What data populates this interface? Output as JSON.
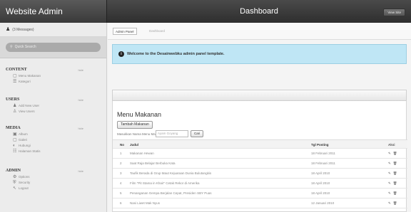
{
  "header": {
    "brand": "Website Admin",
    "title": "Dashboard",
    "view_site": "View Site"
  },
  "sidebar": {
    "messages": "(3 Messages)",
    "search_placeholder": "Quick Search",
    "sections": [
      {
        "title": "CONTENT",
        "toggle": "hide",
        "items": [
          {
            "icon": "document-icon",
            "glyph": "▢",
            "label": "Menu Makanan"
          },
          {
            "icon": "list-icon",
            "glyph": "☰",
            "label": "Kategori"
          }
        ]
      },
      {
        "title": "USERS",
        "toggle": "hide",
        "items": [
          {
            "icon": "add-user-icon",
            "glyph": "♟",
            "label": "Add New User"
          },
          {
            "icon": "users-icon",
            "glyph": "♙",
            "label": "View Users"
          }
        ]
      },
      {
        "title": "MEDIA",
        "toggle": "hide",
        "items": [
          {
            "icon": "album-icon",
            "glyph": "▣",
            "label": "Album"
          },
          {
            "icon": "gallery-icon",
            "glyph": "▢",
            "label": "Galeri"
          },
          {
            "icon": "hubungi-icon",
            "glyph": "◐",
            "label": "Hubungi"
          },
          {
            "icon": "stats-icon",
            "glyph": "☷",
            "label": "Halaman Statis"
          }
        ]
      },
      {
        "title": "ADMIN",
        "toggle": "hide",
        "items": [
          {
            "icon": "options-icon",
            "glyph": "⚙",
            "label": "Options"
          },
          {
            "icon": "security-icon",
            "glyph": "⛨",
            "label": "Security"
          },
          {
            "icon": "logout-icon",
            "glyph": "↖",
            "label": "Logout"
          }
        ]
      }
    ]
  },
  "breadcrumb": {
    "active": "Admin Panel",
    "inactive": "Dashboard"
  },
  "notice": "Welcome to the Desainwebku admin panel template.",
  "panel": {
    "title": "Menu Makanan",
    "add_button": "Tambah Makanan",
    "search_label": "Masukkan Nama Menu Makanan :",
    "search_placeholder": "Ayam Goyang",
    "search_button": "Cari",
    "columns": {
      "no": "No",
      "judul": "Judul",
      "tgl": "Tgl Posting",
      "aksi": "Aksi"
    },
    "rows": [
      {
        "no": "1",
        "judul": "Makanan Hewan",
        "tgl": "18 Februari 2011"
      },
      {
        "no": "2",
        "judul": "Saat Raja Belajar Berbuka Kata",
        "tgl": "18 Februari 2011"
      },
      {
        "no": "3",
        "judul": "Taufik Berada di Grup Maut Kejuaraan Dunia Bulutangkis",
        "tgl": "18 April 2010"
      },
      {
        "no": "4",
        "judul": "Film \"Pit Stama in Khair\" Cetak Rekor di Amerika",
        "tgl": "18 April 2010"
      },
      {
        "no": "5",
        "judul": "Penanganan Gempa Berjalan Cepat, Presiden SBY Puas",
        "tgl": "18 April 2010"
      },
      {
        "no": "6",
        "judul": "Nasi Liwet Mak Nyus",
        "tgl": "12 Januari 2010"
      }
    ]
  }
}
